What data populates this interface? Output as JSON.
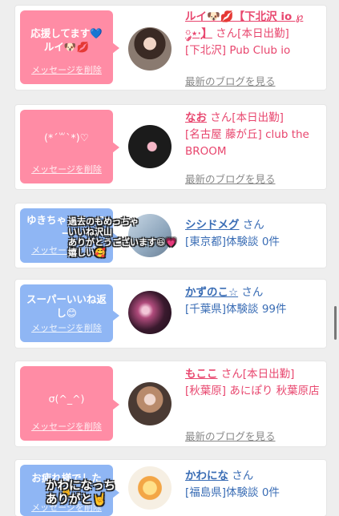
{
  "cards": [
    {
      "message": "応援してます💙ルイ🐶💋",
      "delete": "メッセージを削除",
      "name": "ルイ🐶💋【下北沢 io ℘ ༘⋆·̩͙】",
      "san": "さん",
      "status": "[本日出勤]",
      "shop": "[下北沢] Pub Club io",
      "blog": "最新のブログを見る"
    },
    {
      "message": "(*´꒳`*)♡",
      "delete": "メッセージを削除",
      "name": "なお",
      "san": "さん",
      "status": "[本日出勤]",
      "shop": "[名古屋 藤が丘] club the BROOM",
      "blog": "最新のブログを見る"
    },
    {
      "message": "ゆきちゃんフォロー",
      "delete": "メッセージを削除",
      "name": "シシドメグ",
      "san": "さん",
      "shop": "[東京都]体験談 0件",
      "overlay": "過去のもめっちゃ\nいいね沢山\nありがとうございます😆💗\n嬉しい🥰"
    },
    {
      "message": "スーパーいいね返し😊",
      "delete": "メッセージを削除",
      "name": "かずのこ☆",
      "san": "さん",
      "shop": "[千葉県]体験談 99件"
    },
    {
      "message": "σ(^_^)",
      "delete": "メッセージを削除",
      "name": "もここ",
      "san": "さん",
      "status": "[本日出勤]",
      "shop": "[秋葉原] あにぽり 秋葉原店",
      "blog": "最新のブログを見る"
    },
    {
      "message": "お疲れ様でした🤘",
      "delete": "メッセージを削除",
      "name": "かわにな",
      "san": "さん",
      "shop": "[福島県]体験談 0件",
      "overlay": "かわになっち\nありがと🤘"
    }
  ]
}
